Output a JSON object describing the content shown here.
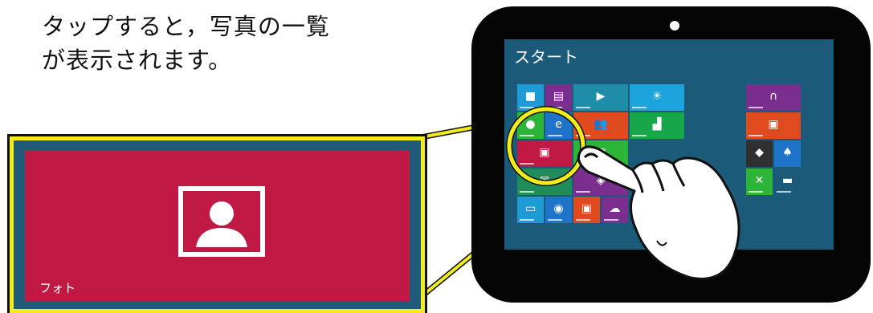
{
  "caption": {
    "line1": "タップすると，写真の一覧",
    "line2": "が表示されます。"
  },
  "zoom_tile": {
    "label": "フォト",
    "icon": "photo-icon",
    "color": "#c01a44"
  },
  "tablet": {
    "screen_title": "スタート",
    "tiles": [
      {
        "name": "store-tile",
        "color": "#2db53a",
        "icon": "bag-icon"
      },
      {
        "name": "news-tile",
        "color": "#8b2f8f",
        "icon": "news-icon"
      },
      {
        "name": "video-tile",
        "color": "#c72f2f",
        "icon": "video-icon"
      },
      {
        "name": "weather-tile",
        "color": "#1ea4dd",
        "icon": "sun-icon"
      },
      {
        "name": "music-tile",
        "color": "#d9451e",
        "icon": "headphones-icon"
      },
      {
        "name": "people-tile",
        "color": "#e04a1f",
        "icon": "people-icon"
      },
      {
        "name": "finance-tile",
        "color": "#17a64a",
        "icon": "chart-icon"
      },
      {
        "name": "photos-tile",
        "color": "#c01a44",
        "icon": "photo-icon"
      },
      {
        "name": "ie-tile",
        "color": "#1f73c9",
        "icon": "ie-icon"
      },
      {
        "name": "calendar-tile",
        "color": "#2db53a",
        "icon": "calendar-icon"
      },
      {
        "name": "games-tile",
        "color": "#2db53a",
        "icon": "xbox-icon"
      }
    ]
  }
}
